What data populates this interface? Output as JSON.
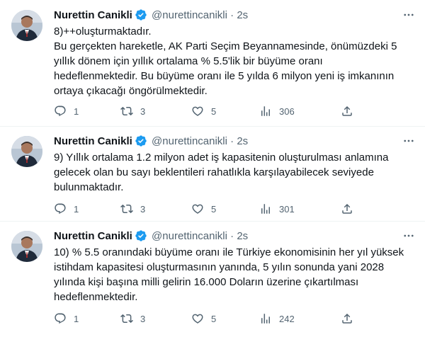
{
  "tweets": [
    {
      "name": "Nurettin Canikli",
      "handle": "@nurettincanikli",
      "time": "2s",
      "text": "8)++oluşturmaktadır.\nBu gerçekten hareketle, AK Parti Seçim Beyannamesinde, önümüzdeki 5 yıllık dönem için yıllık ortalama % 5.5'lik bir büyüme oranı hedeflenmektedir. Bu büyüme oranı ile 5 yılda 6 milyon yeni iş imkanının ortaya çıkacağı öngörülmektedir.",
      "replies": "1",
      "retweets": "3",
      "likes": "5",
      "views": "306"
    },
    {
      "name": "Nurettin Canikli",
      "handle": "@nurettincanikli",
      "time": "2s",
      "text": "9) Yıllık ortalama 1.2 milyon adet iş kapasitenin oluşturulması anlamına gelecek olan bu sayı beklentileri rahatlıkla karşılayabilecek seviyede bulunmaktadır.",
      "replies": "1",
      "retweets": "3",
      "likes": "5",
      "views": "301"
    },
    {
      "name": "Nurettin Canikli",
      "handle": "@nurettincanikli",
      "time": "2s",
      "text": "10) % 5.5 oranındaki büyüme oranı ile Türkiye ekonomisinin her yıl yüksek istihdam kapasitesi oluşturmasının yanında, 5 yılın sonunda yani 2028 yılında kişi başına milli gelirin 16.000 Doların üzerine çıkartılması hedeflenmektedir.",
      "replies": "1",
      "retweets": "3",
      "likes": "5",
      "views": "242"
    }
  ],
  "icons": {
    "verified": "verified-badge-icon",
    "more": "more-options-icon",
    "reply": "reply-icon",
    "retweet": "retweet-icon",
    "like": "heart-icon",
    "views": "views-chart-icon",
    "share": "share-icon"
  },
  "colors": {
    "verified": "#1d9bf0",
    "secondary_text": "#536471",
    "divider": "#eff3f4"
  }
}
